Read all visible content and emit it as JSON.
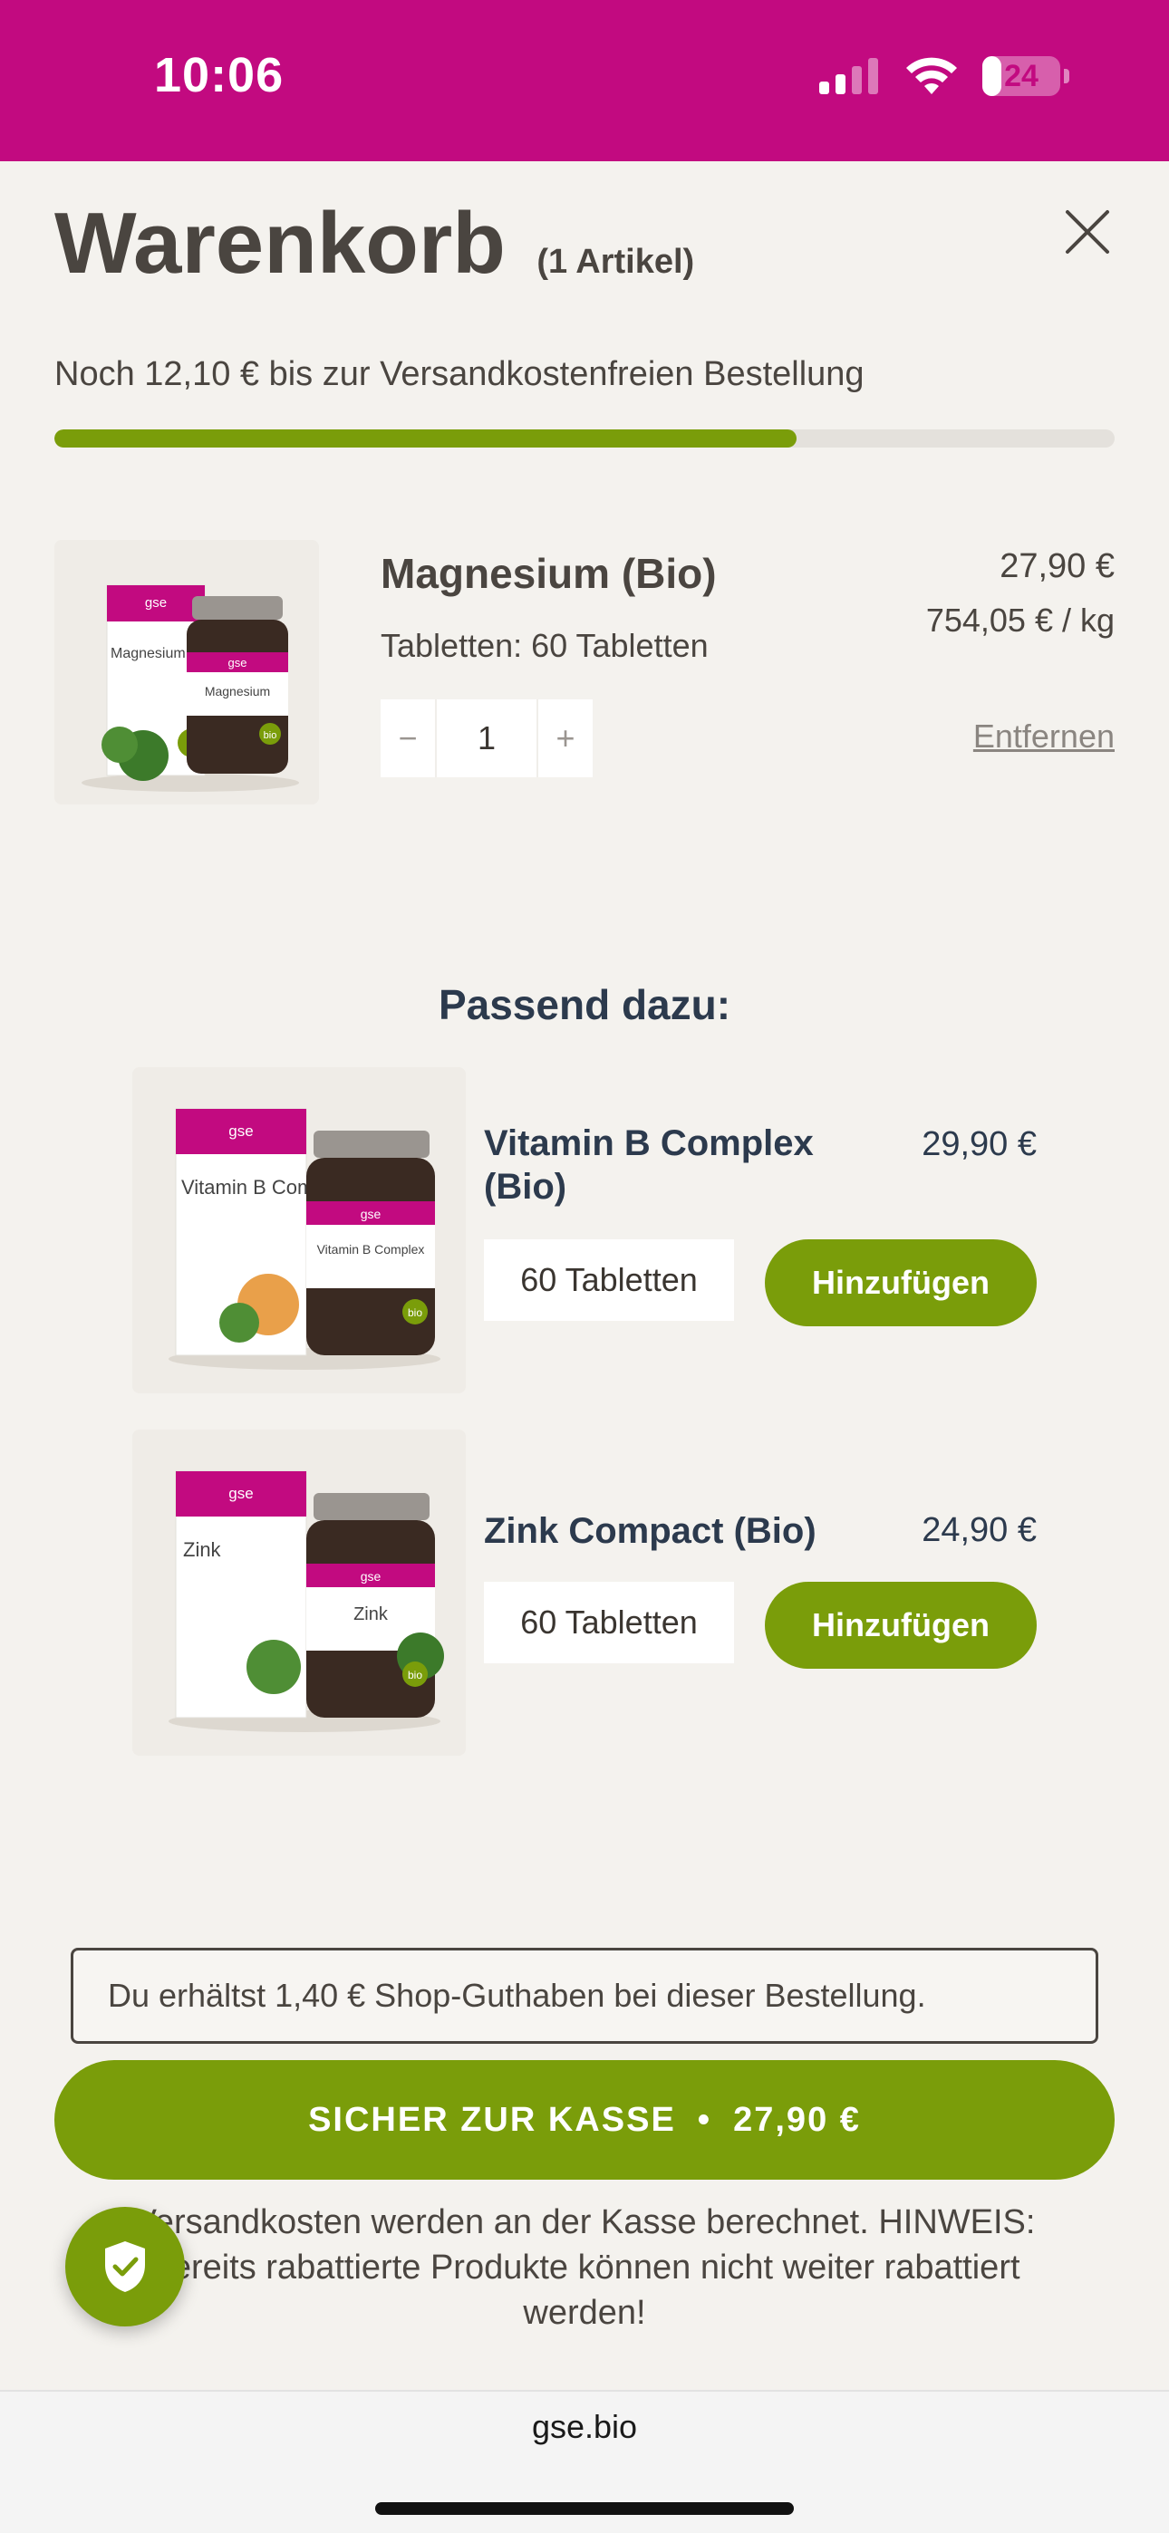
{
  "status_bar": {
    "time": "10:06",
    "battery": "24",
    "battery_level": 0.24
  },
  "header": {
    "title": "Warenkorb",
    "count": "(1 Artikel)"
  },
  "shipping": {
    "note": "Noch 12,10 € bis zur Versandkostenfreien Bestellung",
    "progress": 0.7
  },
  "cart_item": {
    "name": "Magnesium (Bio)",
    "variant": "Tabletten: 60 Tabletten",
    "price": "27,90 €",
    "unit_price": "754,05 € / kg",
    "quantity": "1",
    "decrement": "−",
    "increment": "+",
    "remove_label": "Entfernen",
    "image_text": {
      "brand": "gse",
      "name": "Magnesium",
      "badge": "bio"
    }
  },
  "related": {
    "title": "Passend dazu:",
    "items": [
      {
        "name": "Vitamin B Complex (Bio)",
        "price": "29,90 €",
        "variant": "60 Tabletten",
        "add_label": "Hinzufügen",
        "image_text": {
          "brand": "gse",
          "name": "Vitamin B Complex",
          "badge": "bio"
        }
      },
      {
        "name": "Zink Compact (Bio)",
        "price": "24,90 €",
        "variant": "60 Tabletten",
        "add_label": "Hinzufügen",
        "image_text": {
          "brand": "gse",
          "name": "Zink",
          "badge": "bio"
        }
      }
    ]
  },
  "credit_note": "Du erhältst 1,40 € Shop-Guthaben bei dieser Bestellung.",
  "checkout": {
    "label": "SICHER ZUR KASSE",
    "separator": "•",
    "total": "27,90 €"
  },
  "footnote": "Versandkosten werden an der Kasse berechnet. HINWEIS: Bereits rabattierte Produkte können nicht weiter rabattiert werden!",
  "browser": {
    "url": "gse.bio"
  },
  "colors": {
    "brand_magenta": "#c20a80",
    "accent_green": "#7a9d0a",
    "heading_navy": "#2c3a4d"
  },
  "icons": {
    "close": "close-icon",
    "trust": "shield-check-icon",
    "signal": "signal-icon",
    "wifi": "wifi-icon"
  }
}
